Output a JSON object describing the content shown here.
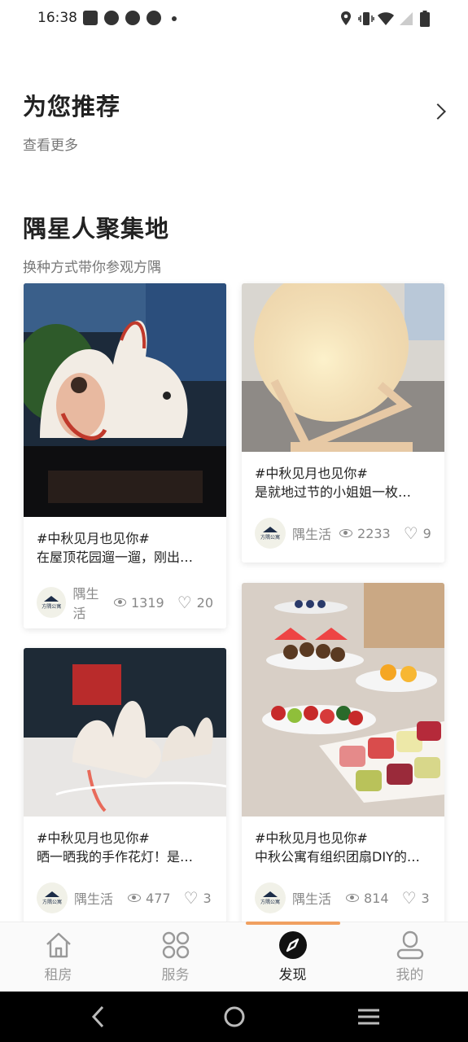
{
  "status_bar": {
    "time": "16:38"
  },
  "recommend": {
    "title": "为您推荐",
    "subtitle": "查看更多"
  },
  "gathering": {
    "title": "隅星人聚集地",
    "subtitle": "换种方式带你参观方隅"
  },
  "cards": [
    {
      "tag": "#中秋见月也见你#",
      "text": "在屋顶花园遛一遛，刚出…",
      "author": "隅生活",
      "views": "1319",
      "likes": "20",
      "avatar_text": "方隅公寓"
    },
    {
      "tag": "#中秋见月也见你#",
      "text": "是就地过节的小姐姐一枚…",
      "author": "隅生活",
      "views": "2233",
      "likes": "9",
      "avatar_text": "方隅公寓"
    },
    {
      "tag": "#中秋见月也见你#",
      "text": "晒一晒我的手作花灯！是…",
      "author": "隅生活",
      "views": "477",
      "likes": "3",
      "avatar_text": "方隅公寓"
    },
    {
      "tag": "#中秋见月也见你#",
      "text": "中秋公寓有组织团扇DIY的…",
      "author": "隅生活",
      "views": "814",
      "likes": "3",
      "avatar_text": "方隅公寓"
    }
  ],
  "tabs": [
    {
      "label": "租房",
      "icon": "house-icon"
    },
    {
      "label": "服务",
      "icon": "grid-icon"
    },
    {
      "label": "发现",
      "icon": "compass-icon",
      "active": true
    },
    {
      "label": "我的",
      "icon": "user-icon"
    }
  ],
  "colors": {
    "accent": "#f0a060",
    "text": "#222222",
    "muted": "#888888"
  }
}
